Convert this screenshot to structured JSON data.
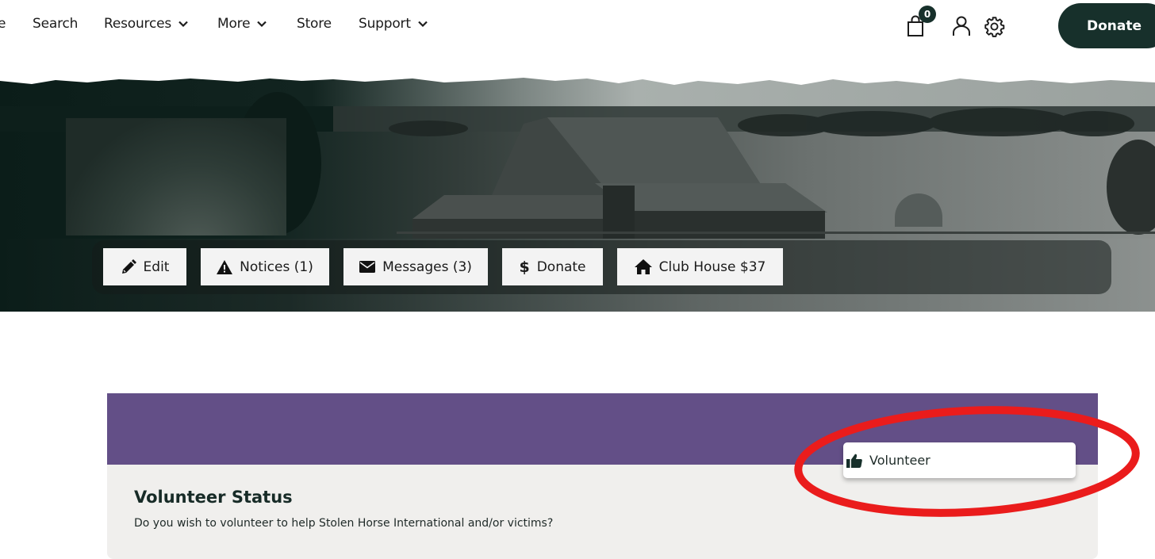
{
  "nav": {
    "partial_item": "e",
    "items": [
      {
        "label": "Search",
        "has_dropdown": false
      },
      {
        "label": "Resources",
        "has_dropdown": true
      },
      {
        "label": "More",
        "has_dropdown": true
      },
      {
        "label": "Store",
        "has_dropdown": false
      },
      {
        "label": "Support",
        "has_dropdown": true
      }
    ],
    "cart_count": "0",
    "icons": [
      "shopping-bag-icon",
      "user-icon",
      "gear-icon"
    ],
    "donate_label": "Donate"
  },
  "profile": {
    "actions": [
      {
        "label": "Edit",
        "icon": "pencil-icon"
      },
      {
        "label": "Notices (1)",
        "icon": "warning-icon"
      },
      {
        "label": "Messages (3)",
        "icon": "envelope-icon"
      },
      {
        "label": "Donate",
        "icon": "dollar-icon"
      },
      {
        "label": "Club House $37",
        "icon": "home-icon"
      }
    ]
  },
  "volunteer": {
    "title": "Volunteer Status",
    "description": "Do you wish to volunteer to help Stolen Horse International and/or victims?",
    "button_label": "Volunteer",
    "button_icon": "thumbs-up-icon"
  },
  "colors": {
    "brand_dark": "#17302b",
    "band_purple": "#634f87",
    "card_bg": "#f0efed",
    "annotation_red": "#ea1c1c"
  }
}
